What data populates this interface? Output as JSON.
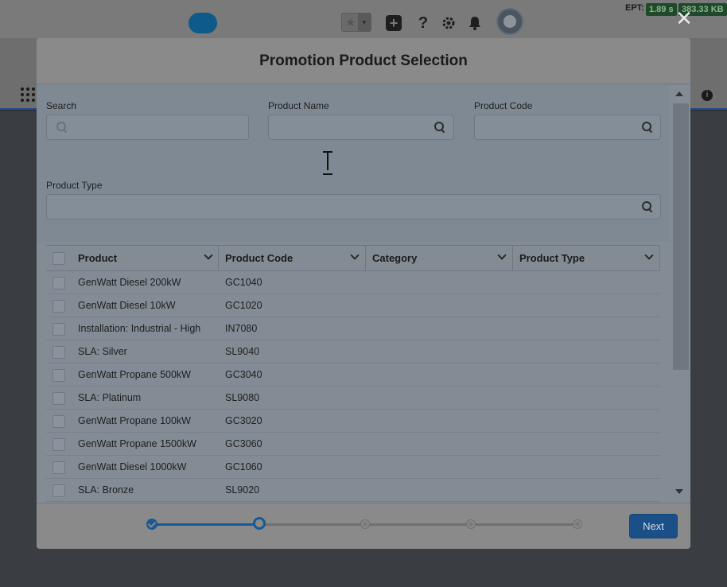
{
  "header": {
    "ept_label": "EPT:",
    "ept_time": "1.89 s",
    "ept_size": "383.33 KB",
    "help_glyph": "?",
    "plus_glyph": "+",
    "info_glyph": "i",
    "close_glyph": "✕",
    "star_glyph": "★",
    "dropdown_glyph": "▾"
  },
  "modal": {
    "title": "Promotion Product Selection",
    "filters": {
      "search_label": "Search",
      "search_value": "",
      "product_name_label": "Product Name",
      "product_name_value": "",
      "product_code_label": "Product Code",
      "product_code_value": "",
      "product_type_label": "Product Type",
      "product_type_value": ""
    },
    "table": {
      "columns": [
        "Product",
        "Product Code",
        "Category",
        "Product Type"
      ],
      "rows": [
        {
          "product": "GenWatt Diesel 200kW",
          "code": "GC1040",
          "category": "",
          "type": ""
        },
        {
          "product": "GenWatt Diesel 10kW",
          "code": "GC1020",
          "category": "",
          "type": ""
        },
        {
          "product": "Installation: Industrial - High",
          "code": "IN7080",
          "category": "",
          "type": ""
        },
        {
          "product": "SLA: Silver",
          "code": "SL9040",
          "category": "",
          "type": ""
        },
        {
          "product": "GenWatt Propane 500kW",
          "code": "GC3040",
          "category": "",
          "type": ""
        },
        {
          "product": "SLA: Platinum",
          "code": "SL9080",
          "category": "",
          "type": ""
        },
        {
          "product": "GenWatt Propane 100kW",
          "code": "GC3020",
          "category": "",
          "type": ""
        },
        {
          "product": "GenWatt Propane 1500kW",
          "code": "GC3060",
          "category": "",
          "type": ""
        },
        {
          "product": "GenWatt Diesel 1000kW",
          "code": "GC1060",
          "category": "",
          "type": ""
        },
        {
          "product": "SLA: Bronze",
          "code": "SL9020",
          "category": "",
          "type": ""
        }
      ]
    },
    "progress": {
      "total_steps": 5,
      "current_step": 2
    },
    "next_label": "Next"
  },
  "colors": {
    "accent": "#1b5896",
    "overlay": "#2f3337"
  }
}
